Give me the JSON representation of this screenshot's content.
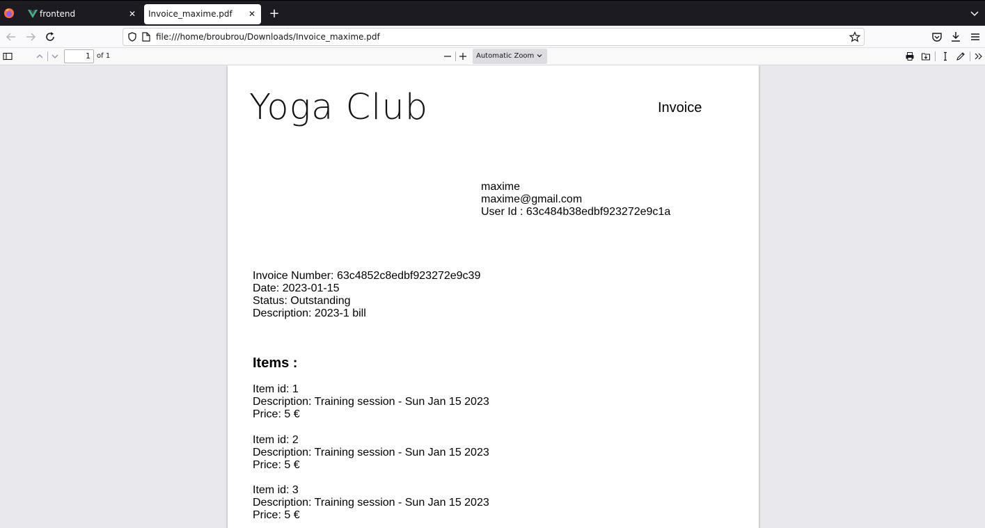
{
  "tabs": [
    {
      "title": "frontend",
      "active": false
    },
    {
      "title": "Invoice_maxime.pdf",
      "active": true
    }
  ],
  "navbar": {
    "url": "file:///home/broubrou/Downloads/Invoice_maxime.pdf"
  },
  "pdf_toolbar": {
    "page_current": "1",
    "page_of": "of 1",
    "zoom": "Automatic Zoom"
  },
  "document": {
    "brand": "Yoga Club",
    "title": "Invoice",
    "customer": {
      "name": "maxime",
      "email": "maxime@gmail.com",
      "user_id": "User Id : 63c484b38edbf923272e9c1a"
    },
    "invoice": {
      "number": "Invoice Number: 63c4852c8edbf923272e9c39",
      "date": "Date: 2023-01-15",
      "status": "Status: Outstanding",
      "description": "Description: 2023-1 bill"
    },
    "items_heading": "Items :",
    "items": [
      {
        "id": "Item id: 1",
        "description": "Description: Training session - Sun Jan 15 2023",
        "price": "Price: 5 €"
      },
      {
        "id": "Item id: 2",
        "description": "Description: Training session - Sun Jan 15 2023",
        "price": "Price: 5 €"
      },
      {
        "id": "Item id: 3",
        "description": "Description: Training session - Sun Jan 15 2023",
        "price": "Price: 5 €"
      }
    ]
  },
  "colors": {
    "tabstrip_bg": "#1c1b22",
    "toolbar_bg": "#f9f9fb",
    "viewer_bg": "#e9e9ed",
    "vue_green": "#41b883"
  }
}
